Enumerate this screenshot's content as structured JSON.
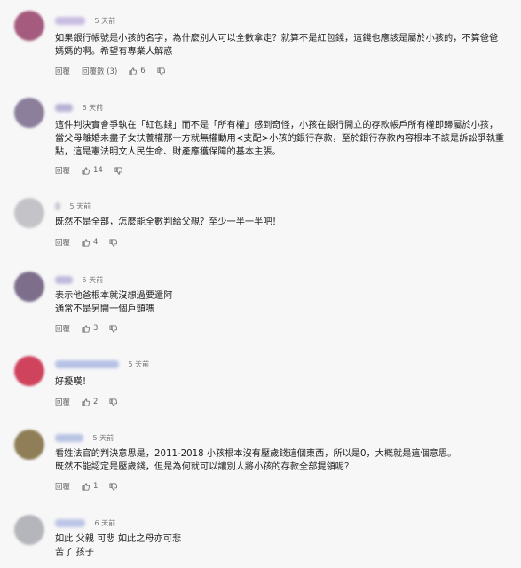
{
  "comments": [
    {
      "time": "5 天前",
      "avatar_color": "#a45b7e",
      "name_color": "#c9bde0",
      "lines": [
        "如果銀行帳號是小孩的名字，為什麼別人可以全數拿走？就算不是紅包錢，這錢也應該是屬於小孩的，不算爸爸",
        "媽媽的啊。希望有專業人解惑"
      ],
      "reply": "回覆",
      "replies": "回覆數 (3)",
      "likes": "6"
    },
    {
      "time": "6 天前",
      "avatar_color": "#8c7f9b",
      "name_color": "#b9b3d6",
      "lines": [
        "這件判決實會爭執在「紅包錢」而不是「所有權」感到奇怪，小孩在銀行開立的存款帳戶所有權即歸屬於小孩，",
        "當父母離婚未盡子女扶養權那一方就無權動用<支配>小孩的銀行存款，至於銀行存款內容根本不該是訴訟爭執重",
        "點，這是憲法明文人民生命、財產應獲保障的基本主張。"
      ],
      "reply": "回覆",
      "likes": "14"
    },
    {
      "time": "5 天前",
      "avatar_color": "#c4c4c8",
      "name_color": "#c8c8d4",
      "lines": [
        "既然不是全部，怎麼能全數判給父親？至少一半一半吧！"
      ],
      "reply": "回覆",
      "likes": "4"
    },
    {
      "time": "5 天前",
      "avatar_color": "#7d6f8c",
      "name_color": "#c2b9dc",
      "lines": [
        "表示他爸根本就沒想過要還阿",
        "通常不是另開一個戶頭嗎"
      ],
      "reply": "回覆",
      "likes": "3"
    },
    {
      "time": "5 天前",
      "avatar_color": "#d0435c",
      "name_color": "#b7c2e6",
      "lines": [
        "好擾嘆！"
      ],
      "reply": "回覆",
      "likes": "2"
    },
    {
      "time": "5 天前",
      "avatar_color": "#8f7e57",
      "name_color": "#b8c4e4",
      "lines": [
        "看姓法官的判決意思是，2011-2018 小孩根本沒有壓歲錢這個東西，所以是0，大概就是這個意思。",
        "既然不能認定是壓歲錢，但是為何就可以讓別人將小孩的存款全部提領呢？"
      ],
      "reply": "回覆",
      "likes": "1"
    },
    {
      "time": "6 天前",
      "avatar_color": "#b5b5bc",
      "name_color": "#bcc6e6",
      "lines": [
        "如此 父親 可悲 如此之母亦可悲",
        "苦了 孩子"
      ],
      "reply": "回覆",
      "likes": ""
    }
  ],
  "icons": {
    "like": "thumb-up-icon",
    "dislike": "thumb-down-icon"
  }
}
